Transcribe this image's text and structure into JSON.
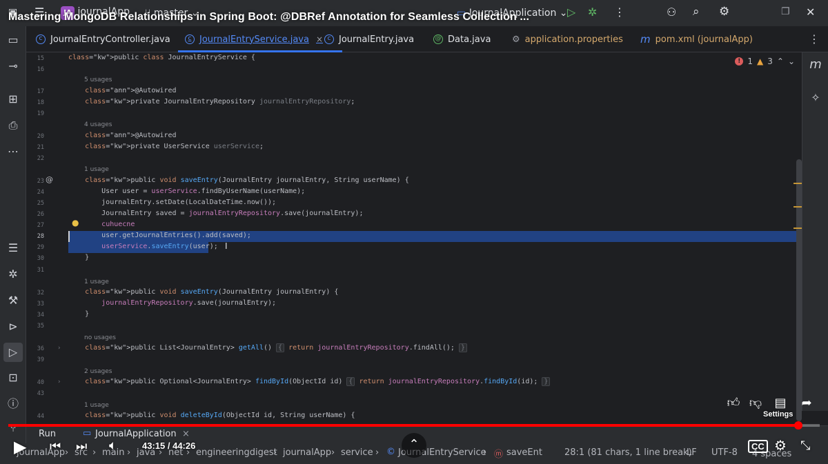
{
  "video": {
    "title": "Mastering MongoDB Relationships in Spring Boot: @DBRef Annotation for Seamless Collection ...",
    "time": "43:15 / 44:26",
    "progress_fraction": 0.974,
    "settings_tooltip": "Settings"
  },
  "ide": {
    "project_badge": "JA",
    "project": "journalApp",
    "branch": "master",
    "run_config": "JournalApplication",
    "tabs": [
      {
        "label": "JournalEntryController.java",
        "icon": "class-icon"
      },
      {
        "label": "JournalEntryService.java",
        "icon": "class-icon"
      },
      {
        "label": "JournalEntry.java",
        "icon": "class-icon"
      },
      {
        "label": "Data.java",
        "icon": "annotation-icon"
      },
      {
        "label": "application.properties",
        "icon": "gear-icon"
      },
      {
        "label": "pom.xml (journalApp)",
        "icon": "maven-icon"
      }
    ],
    "tab_close": "×",
    "inspections": {
      "errors": "1",
      "warnings": "3"
    },
    "run_label": "Run",
    "run_target": "JournalApplication",
    "run_close": "×",
    "breadcrumb": [
      "journalApp",
      "src",
      "main",
      "java",
      "net",
      "engineeringdigest",
      "journalApp",
      "service",
      "JournalEntryService",
      "saveEnt"
    ],
    "status": {
      "position": "28:1 (81 chars, 1 line break)",
      "line_sep": "LF",
      "encoding": "UTF-8",
      "indent": "4 spaces"
    }
  },
  "code": {
    "lines": [
      {
        "n": "15",
        "text": "public class JournalEntryService {"
      },
      {
        "n": "16",
        "text": ""
      },
      {
        "n": "17",
        "text": "    @Autowired"
      },
      {
        "n": "18",
        "text": "    private JournalEntryRepository journalEntryRepository;"
      },
      {
        "n": "19",
        "text": ""
      },
      {
        "n": "20",
        "text": "    @Autowired"
      },
      {
        "n": "21",
        "text": "    private UserService userService;"
      },
      {
        "n": "22",
        "text": ""
      },
      {
        "n": "23",
        "text": "    public void saveEntry(JournalEntry journalEntry, String userName) {"
      },
      {
        "n": "24",
        "text": "        User user = userService.findByUserName(userName);"
      },
      {
        "n": "25",
        "text": "        journalEntry.setDate(LocalDateTime.now());"
      },
      {
        "n": "26",
        "text": "        JournalEntry saved = journalEntryRepository.save(journalEntry);"
      },
      {
        "n": "27",
        "text": "        cuhuecne"
      },
      {
        "n": "28",
        "text": "        user.getJournalEntries().add(saved);"
      },
      {
        "n": "29",
        "text": "        userService.saveEntry(user);"
      },
      {
        "n": "30",
        "text": "    }"
      },
      {
        "n": "31",
        "text": ""
      },
      {
        "n": "32",
        "text": "    public void saveEntry(JournalEntry journalEntry) {"
      },
      {
        "n": "33",
        "text": "        journalEntryRepository.save(journalEntry);"
      },
      {
        "n": "34",
        "text": "    }"
      },
      {
        "n": "35",
        "text": ""
      },
      {
        "n": "36",
        "text": "    public List<JournalEntry> getAll() { return journalEntryRepository.findAll(); }"
      },
      {
        "n": "39",
        "text": ""
      },
      {
        "n": "40",
        "text": "    public Optional<JournalEntry> findById(ObjectId id) { return journalEntryRepository.findById(id); }"
      },
      {
        "n": "43",
        "text": ""
      },
      {
        "n": "44",
        "text": "    public void deleteById(ObjectId id, String userName) {"
      }
    ],
    "usages": [
      "5 usages",
      "4 usages",
      "1 usage",
      "1 usage",
      "no usages",
      "2 usages",
      "1 usage"
    ]
  }
}
